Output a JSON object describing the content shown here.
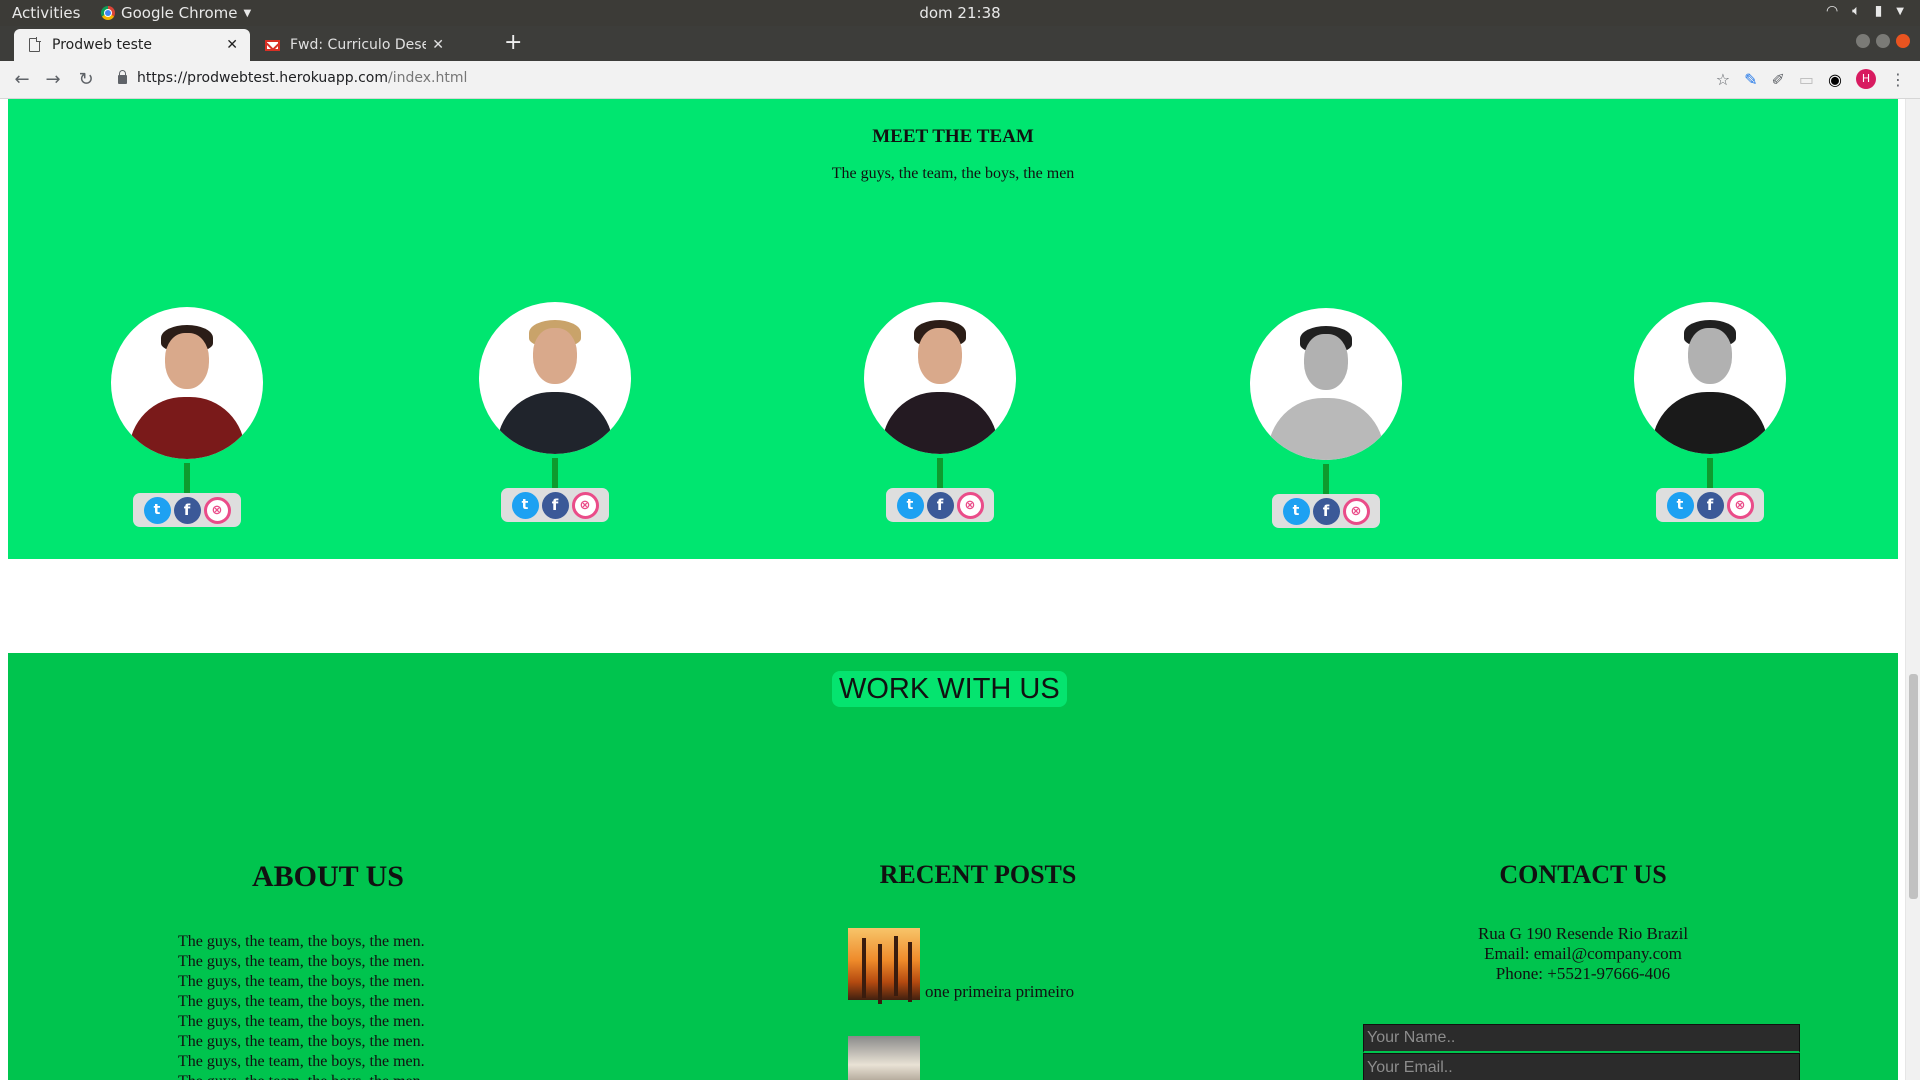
{
  "os": {
    "activities": "Activities",
    "app_menu": "Google Chrome",
    "clock": "dom 21:38"
  },
  "browser": {
    "tabs": [
      {
        "title": "Prodweb teste",
        "active": true
      },
      {
        "title": "Fwd: Curriculo Desenvolv",
        "active": false
      }
    ],
    "url_host": "https://prodwebtest.herokuapp.com",
    "url_path": "/index.html",
    "profile_initial": "H"
  },
  "team": {
    "title": "MEET THE TEAM",
    "subtitle": "The guys, the team, the boys, the men",
    "members": [
      {
        "shirt": "#7a1a1a",
        "socials": [
          "twitter-icon",
          "facebook-icon",
          "dribbble-icon"
        ]
      },
      {
        "shirt": "#20242c",
        "socials": [
          "twitter-icon",
          "facebook-icon",
          "dribbble-icon"
        ]
      },
      {
        "shirt": "#241a22",
        "socials": [
          "twitter-icon",
          "facebook-icon",
          "dribbble-icon"
        ]
      },
      {
        "shirt": "#b9b9b9",
        "socials": [
          "twitter-icon",
          "facebook-icon",
          "dribbble-icon"
        ]
      },
      {
        "shirt": "#1a1a1a",
        "socials": [
          "twitter-icon",
          "facebook-icon",
          "dribbble-icon"
        ]
      }
    ]
  },
  "work": {
    "banner": "WORK WITH US",
    "about": {
      "title": "ABOUT US",
      "lines": [
        "The guys, the team, the boys, the men.",
        "The guys, the team, the boys, the men.",
        "The guys, the team, the boys, the men.",
        "The guys, the team, the boys, the men.",
        "The guys, the team, the boys, the men.",
        "The guys, the team, the boys, the men.",
        "The guys, the team, the boys, the men.",
        "The guys, the team, the boys, the men."
      ]
    },
    "posts": {
      "title": "RECENT POSTS",
      "items": [
        {
          "title": "one primeira primeiro"
        },
        {
          "title": ""
        }
      ]
    },
    "contact": {
      "title": "CONTACT US",
      "address": "Rua G 190 Resende Rio Brazil",
      "email": "Email: email@company.com",
      "phone": "Phone: +5521-97666-406",
      "name_placeholder": "Your Name..",
      "email_placeholder": "Your Email.."
    }
  },
  "colors": {
    "team_bg": "#00e670",
    "work_bg": "#00c44e",
    "stem": "#0e9b2e"
  }
}
